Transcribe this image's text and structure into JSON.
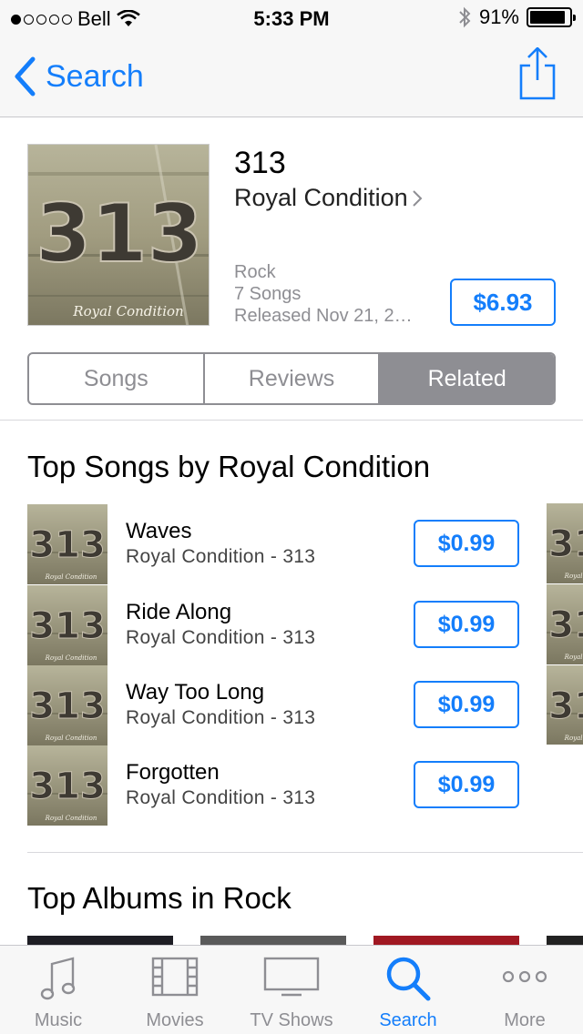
{
  "status_bar": {
    "carrier": "Bell",
    "time": "5:33 PM",
    "battery_percent": "91%",
    "battery_level": 0.91,
    "signal_bars_filled": 1,
    "signal_bars_total": 5
  },
  "nav": {
    "back_label": "Search",
    "accent_color": "#147efb"
  },
  "album": {
    "title": "313",
    "artist": "Royal Condition",
    "genre": "Rock",
    "song_count": "7 Songs",
    "released": "Released Nov 21, 2…",
    "price": "$6.93",
    "art_text": "313",
    "art_caption": "Royal Condition"
  },
  "segments": {
    "items": [
      "Songs",
      "Reviews",
      "Related"
    ],
    "selected": "Related"
  },
  "top_songs": {
    "title": "Top Songs by Royal Condition",
    "songs": [
      {
        "name": "Waves",
        "subtitle": "Royal Condition - 313",
        "price": "$0.99"
      },
      {
        "name": "Ride Along",
        "subtitle": "Royal Condition - 313",
        "price": "$0.99"
      },
      {
        "name": "Way Too Long",
        "subtitle": "Royal Condition - 313",
        "price": "$0.99"
      },
      {
        "name": "Forgotten",
        "subtitle": "Royal Condition - 313",
        "price": "$0.99"
      }
    ]
  },
  "top_albums": {
    "title": "Top Albums in Rock"
  },
  "tab_bar": {
    "tabs": [
      {
        "label": "Music",
        "icon": "music-note-icon"
      },
      {
        "label": "Movies",
        "icon": "film-icon"
      },
      {
        "label": "TV Shows",
        "icon": "tv-icon"
      },
      {
        "label": "Search",
        "icon": "search-icon"
      },
      {
        "label": "More",
        "icon": "more-icon"
      }
    ],
    "selected": "Search"
  }
}
